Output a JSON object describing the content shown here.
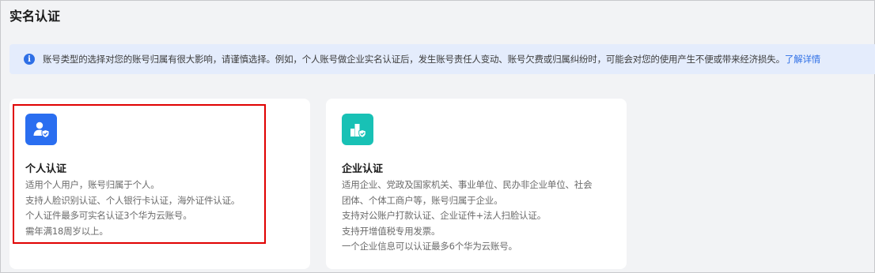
{
  "page": {
    "title": "实名认证"
  },
  "notice": {
    "icon": "info-icon",
    "text": "账号类型的选择对您的账号归属有很大影响，请谨慎选择。例如，个人账号做企业实名认证后，发生账号责任人变动、账号欠费或归属纠纷时，可能会对您的使用产生不便或带来经济损失。",
    "link": "了解详情"
  },
  "cards": [
    {
      "icon": "personal-user-shield-icon",
      "title": "个人认证",
      "lines": [
        "适用个人用户，账号归属于个人。",
        "支持人脸识别认证、个人银行卡认证，海外证件认证。",
        "个人证件最多可实名认证3个华为云账号。",
        "需年满18周岁以上。"
      ]
    },
    {
      "icon": "enterprise-building-shield-icon",
      "title": "企业认证",
      "lines": [
        "适用企业、党政及国家机关、事业单位、民办非企业单位、社会",
        "团体、个体工商户等，账号归属于企业。",
        "支持对公账户打款认证、企业证件+法人扫脸认证。",
        "支持开增值税专用发票。",
        "一个企业信息可以认证最多6个华为云账号。"
      ]
    }
  ],
  "colors": {
    "accent": "#2e6fe6",
    "personal_icon_bg": "#2a6ef0",
    "enterprise_icon_bg": "#18c1b5",
    "highlight_border": "#e00000"
  }
}
